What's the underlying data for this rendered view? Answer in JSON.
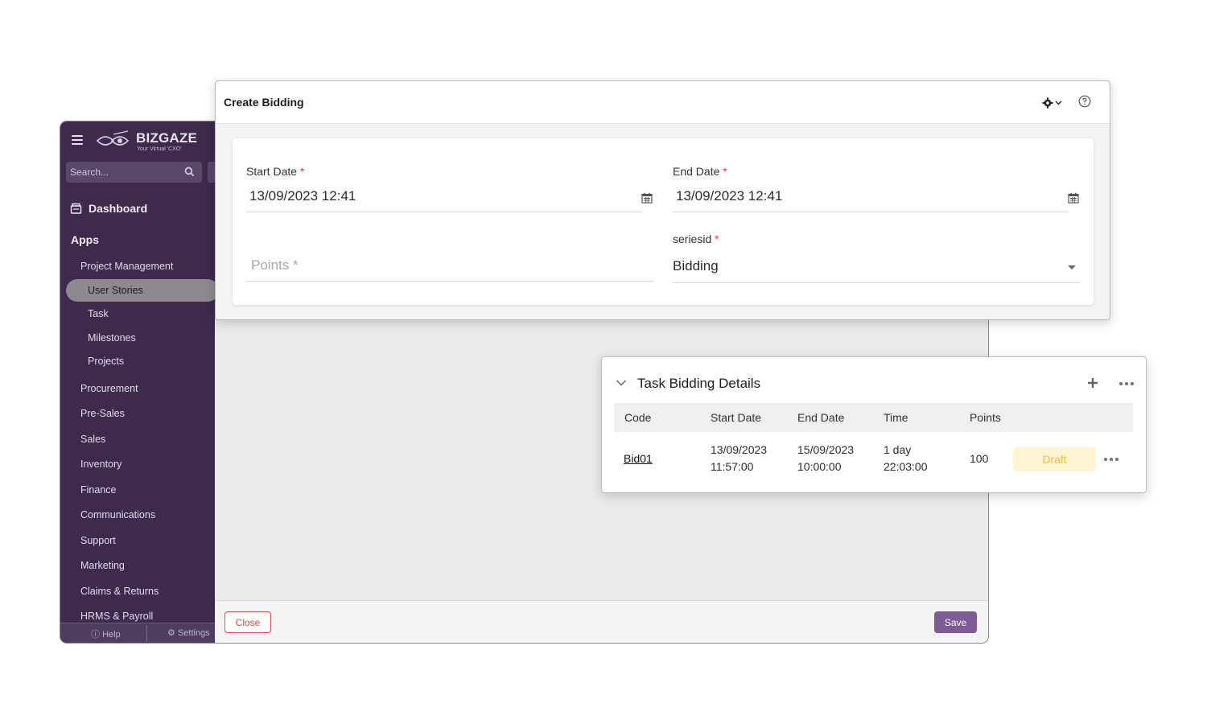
{
  "sidebar": {
    "logo_text": "BIZGAZE",
    "logo_sub": "Your Virtual 'CXO'",
    "search_placeholder": "Search...",
    "dashboard_label": "Dashboard",
    "apps_label": "Apps",
    "items": [
      {
        "label": "Project Management"
      },
      {
        "label": "User Stories"
      },
      {
        "label": "Task"
      },
      {
        "label": "Milestones"
      },
      {
        "label": "Projects"
      },
      {
        "label": "Procurement"
      },
      {
        "label": "Pre-Sales"
      },
      {
        "label": "Sales"
      },
      {
        "label": "Inventory"
      },
      {
        "label": "Finance"
      },
      {
        "label": "Communications"
      },
      {
        "label": "Support"
      },
      {
        "label": "Marketing"
      },
      {
        "label": "Claims & Returns"
      },
      {
        "label": "HRMS & Payroll"
      }
    ],
    "footer": {
      "help_label": "Help",
      "settings_label": "Settings"
    }
  },
  "footer": {
    "close_label": "Close",
    "save_label": "Save"
  },
  "dialog": {
    "title": "Create Bidding",
    "start_date": {
      "label": "Start Date",
      "value": "13/09/2023 12:41"
    },
    "end_date": {
      "label": "End Date",
      "value": "13/09/2023 12:41"
    },
    "points": {
      "placeholder": "Points *"
    },
    "seriesid": {
      "label": "seriesid",
      "value": "Bidding"
    },
    "required_mark": "*"
  },
  "task_card": {
    "title": "Task Bidding Details",
    "columns": [
      "Code",
      "Start Date",
      "End Date",
      "Time",
      "Points"
    ],
    "rows": [
      {
        "code": "Bid01",
        "start_date": "13/09/2023",
        "start_time": "11:57:00",
        "end_date": "15/09/2023",
        "end_time": "10:00:00",
        "time_1": "1 day",
        "time_2": "22:03:00",
        "points": "100",
        "status": "Draft"
      }
    ]
  },
  "colors": {
    "sidebar_bg": "#3e2a4d",
    "accent": "#7d5b94",
    "danger": "#e04b4b",
    "draft_badge_bg": "#fff4d3",
    "draft_badge_text": "#f2bf3b"
  }
}
